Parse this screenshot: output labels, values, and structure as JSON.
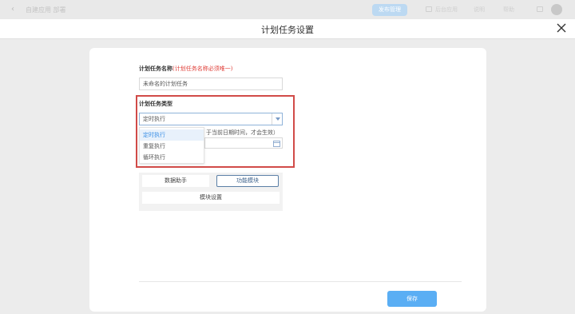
{
  "background": {
    "title": "自建应用 部署",
    "pill_label": "发布管理",
    "items": [
      "后台应用",
      "说明",
      "帮助"
    ]
  },
  "modal": {
    "title": "计划任务设置"
  },
  "form": {
    "name_label": "计划任务名称",
    "name_hint": "(计划任务名称必须唯一)",
    "name_value": "未命名的计划任务",
    "type_label": "计划任务类型",
    "type_value": "定时执行",
    "type_options": [
      "定时执行",
      "重复执行",
      "循环执行"
    ],
    "date_note": "于当前日期时间，才会生效）"
  },
  "tabs": {
    "data_helper": "数据助手",
    "function_module": "功能模块",
    "module_settings": "模块设置"
  },
  "footer": {
    "save_label": "保存"
  },
  "colors": {
    "accent": "#5aaef4",
    "highlight": "#d14b48"
  }
}
